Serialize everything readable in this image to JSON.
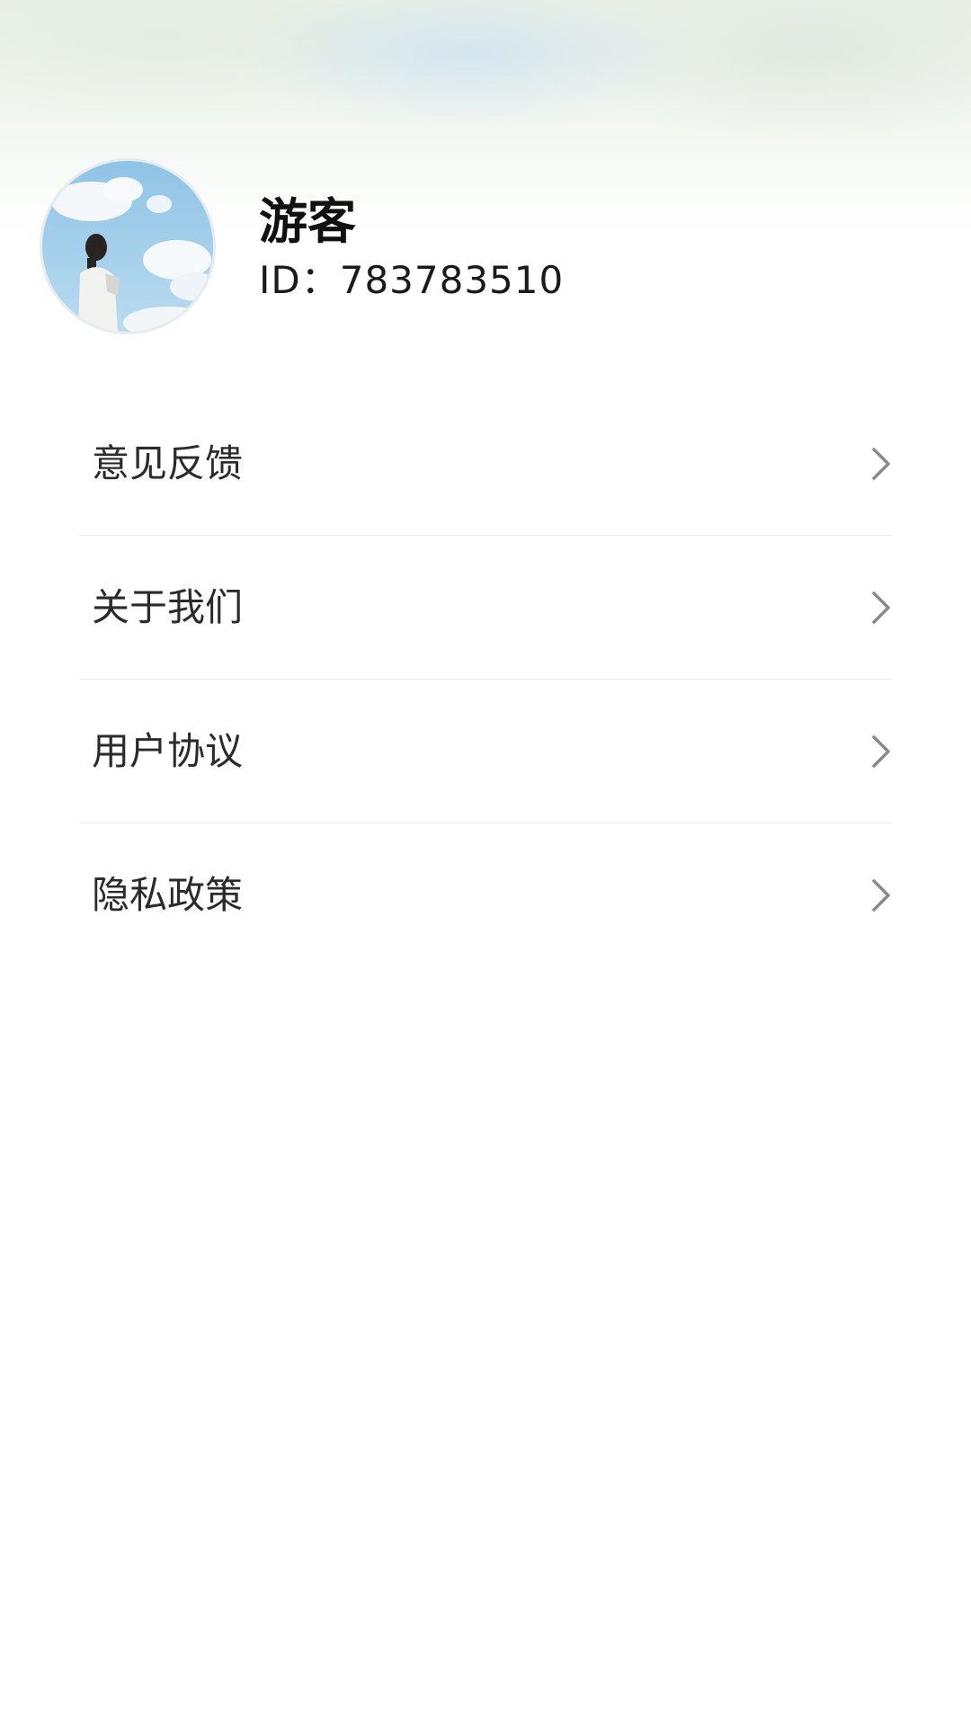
{
  "profile": {
    "avatar_icon": "avatar-photo-girl-clouds",
    "name": "游客",
    "id_text": "ID：783783510"
  },
  "menu": {
    "items": [
      {
        "label": "意见反馈",
        "icon": "chevron-right-icon"
      },
      {
        "label": "关于我们",
        "icon": "chevron-right-icon"
      },
      {
        "label": "用户协议",
        "icon": "chevron-right-icon"
      },
      {
        "label": "隐私政策",
        "icon": "chevron-right-icon"
      }
    ]
  },
  "colors": {
    "background": "#ffffff",
    "divider": "#ececec",
    "chevron": "#8a8a8a",
    "text_primary": "#111111"
  }
}
